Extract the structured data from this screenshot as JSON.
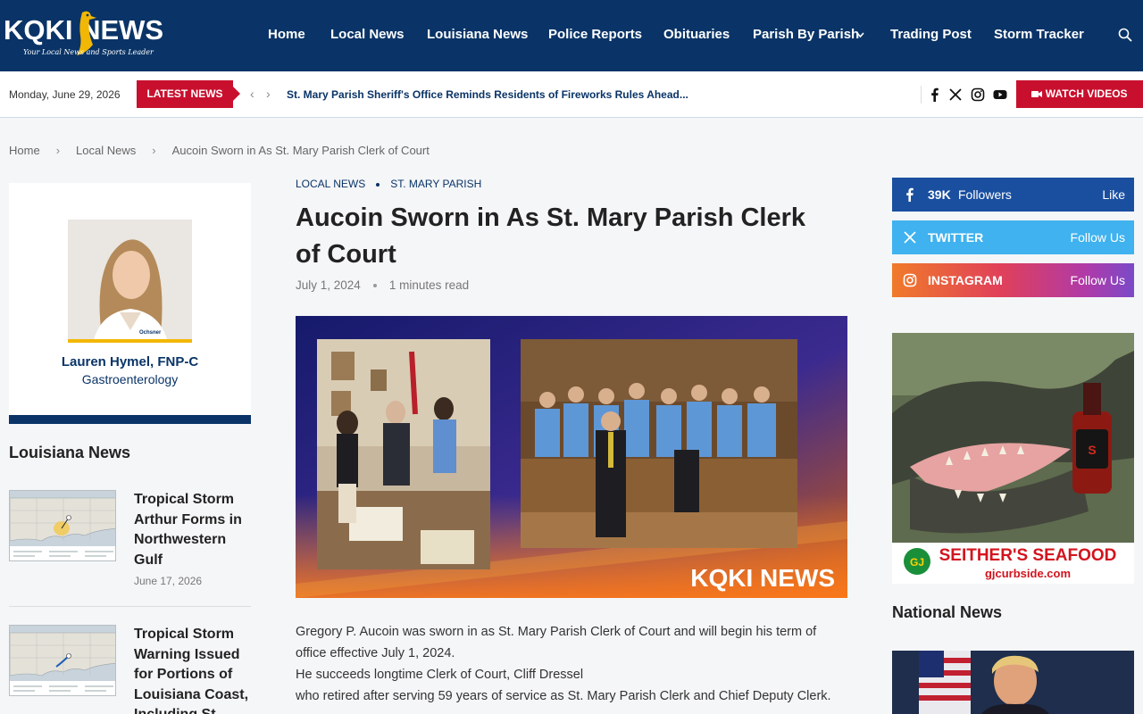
{
  "header": {
    "logo_text": "KQKI NEWS",
    "logo_tagline": "Your Local News and Sports Leader",
    "nav": [
      "Home",
      "Local News",
      "Louisiana News",
      "Police Reports",
      "Obituaries",
      "Parish By Parish",
      "Trading Post",
      "Storm Tracker"
    ],
    "nav_dropdown_marker": "⌄"
  },
  "ticker": {
    "date": "Monday, June 29, 2026",
    "badge": "LATEST NEWS",
    "headline": "St. Mary Parish Sheriff's Office Reminds Residents of Fireworks Rules Ahead...",
    "watch_label": "WATCH VIDEOS"
  },
  "breadcrumb": [
    "Home",
    "Local News",
    "Aucoin Sworn in As St. Mary Parish Clerk of Court"
  ],
  "left_ad": {
    "name": "Lauren Hymel, FNP-C",
    "specialty": "Gastroenterology",
    "badge": "Ochsner"
  },
  "louisiana_news": {
    "title": "Louisiana News",
    "items": [
      {
        "title": "Tropical Storm Arthur Forms in Northwestern Gulf",
        "date": "June 17, 2026"
      },
      {
        "title": "Tropical Storm Warning Issued for Portions of Louisiana Coast, Including St. Mary",
        "date": ""
      }
    ]
  },
  "article": {
    "categories": [
      "LOCAL NEWS",
      "ST. MARY PARISH"
    ],
    "title": "Aucoin Sworn in As St. Mary Parish Clerk of Court",
    "date": "July 1, 2024",
    "read_time": "1 minutes read",
    "hero_watermark": "KQKI NEWS",
    "body": [
      "Gregory P. Aucoin was sworn in as St. Mary Parish Clerk of Court and will begin his term of office effective July 1, 2024.",
      "He succeeds longtime Clerk of Court, Cliff Dressel",
      "who retired after serving 59 years of service as St. Mary Parish Clerk and Chief Deputy Clerk."
    ]
  },
  "social": {
    "facebook": {
      "count": "39K",
      "label": "Followers",
      "action": "Like",
      "color": "#1a4fa0"
    },
    "twitter": {
      "label": "TWITTER",
      "action": "Follow Us",
      "color": "#3fb2ef"
    },
    "instagram": {
      "label": "INSTAGRAM",
      "action": "Follow Us"
    }
  },
  "right_ad": {
    "brand": "SEITHER'S SEAFOOD",
    "url": "gjcurbside.com",
    "logo": "GJ"
  },
  "national_news": {
    "title": "National News"
  },
  "colors": {
    "brand_blue": "#0a3467",
    "accent_red": "#c8102e"
  }
}
